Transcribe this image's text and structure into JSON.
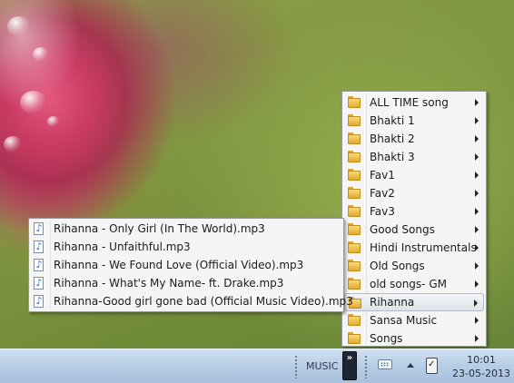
{
  "folder_menu": {
    "items": [
      {
        "label": "ALL TIME song",
        "submenu": true
      },
      {
        "label": "Bhakti 1",
        "submenu": true
      },
      {
        "label": "Bhakti 2",
        "submenu": true
      },
      {
        "label": "Bhakti 3",
        "submenu": true
      },
      {
        "label": "Fav1",
        "submenu": true
      },
      {
        "label": "Fav2",
        "submenu": true
      },
      {
        "label": "Fav3",
        "submenu": true
      },
      {
        "label": "Good Songs",
        "submenu": true
      },
      {
        "label": "Hindi Instrumentals",
        "submenu": true
      },
      {
        "label": "Old Songs",
        "submenu": true
      },
      {
        "label": "old songs- GM",
        "submenu": true
      },
      {
        "label": "Rihanna",
        "submenu": true,
        "highlighted": true
      },
      {
        "label": "Sansa Music",
        "submenu": true
      },
      {
        "label": "Songs",
        "submenu": true
      }
    ]
  },
  "file_menu": {
    "items": [
      {
        "label": "Rihanna - Only Girl (In The World).mp3"
      },
      {
        "label": "Rihanna - Unfaithful.mp3"
      },
      {
        "label": "Rihanna - We Found Love (Official Video).mp3"
      },
      {
        "label": "Rihanna - What's My Name- ft. Drake.mp3"
      },
      {
        "label": "Rihanna-Good girl gone bad (Official Music Video).mp3"
      }
    ]
  },
  "taskbar": {
    "toolbar_label": "MUSIC",
    "chevron": "»",
    "tray_icons": [
      "keyboard-icon",
      "show-hidden-icons-arrow",
      "safely-remove-hardware-icon"
    ],
    "clock": {
      "time": "10:01",
      "date": "23-05-2013"
    }
  },
  "colors": {
    "menu_bg": "#f5f5f5",
    "menu_border": "#979797",
    "highlight_bg": "#e0e4ea",
    "taskbar": "#b7cde6",
    "folder": "#e5ac2c"
  }
}
